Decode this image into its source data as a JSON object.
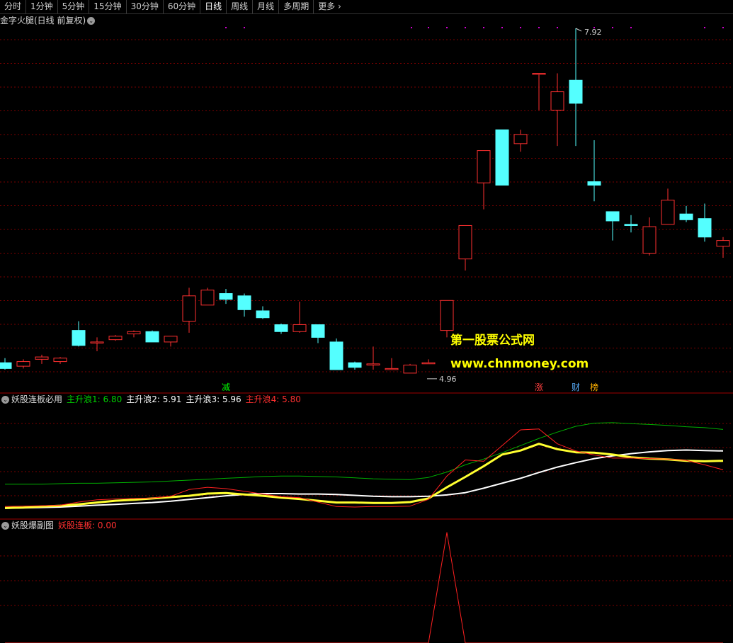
{
  "toolbar": {
    "tabs": [
      {
        "label": "分时"
      },
      {
        "label": "1分钟"
      },
      {
        "label": "5分钟"
      },
      {
        "label": "15分钟"
      },
      {
        "label": "30分钟"
      },
      {
        "label": "60分钟"
      },
      {
        "label": "日线",
        "active": true
      },
      {
        "label": "周线"
      },
      {
        "label": "月线"
      },
      {
        "label": "多周期"
      }
    ],
    "more_label": "更多",
    "more_icon": "chevron-right-icon"
  },
  "main_panel": {
    "title": "金字火腿(日线 前复权)",
    "high_label": "7.92",
    "low_label": "4.96",
    "markers": [
      {
        "text": "减",
        "color": "#00ff00"
      },
      {
        "text": "涨",
        "color": "#ff4040"
      },
      {
        "text": "财",
        "color": "#5ab0ff"
      },
      {
        "text": "榜",
        "color": "#ffb000"
      }
    ],
    "watermark_line1": "第一股票公式网",
    "watermark_line2": "www.chnmoney.com"
  },
  "indicator_panel": {
    "name": "妖股连板必用",
    "legend": [
      {
        "label": "主升浪1: 6.80",
        "color": "#00d000"
      },
      {
        "label": "主升浪2: 5.91",
        "color": "#ffffff"
      },
      {
        "label": "主升浪3: 5.96",
        "color": "#ffffff"
      },
      {
        "label": "主升浪4: 5.80",
        "color": "#ff3030"
      }
    ]
  },
  "sub_panel": {
    "name": "妖股爆副图",
    "legend": [
      {
        "label": "妖股连板: 0.00",
        "color": "#ff3030"
      }
    ]
  },
  "colors": {
    "up": "#ff3030",
    "down": "#54ffff",
    "grid": "#7a0000",
    "separator": "#a00000",
    "ma_green": "#00b000",
    "ma_white": "#ffffff",
    "ma_yellow": "#ffff30",
    "ma_red": "#ff2020"
  },
  "chart_data": [
    {
      "type": "candlestick",
      "title": "金字火腿(日线 前复权)",
      "candles": [
        {
          "o": 5.02,
          "h": 5.06,
          "l": 4.96,
          "c": 4.97
        },
        {
          "o": 4.99,
          "h": 5.05,
          "l": 4.97,
          "c": 5.03
        },
        {
          "o": 5.05,
          "h": 5.09,
          "l": 5.01,
          "c": 5.07
        },
        {
          "o": 5.03,
          "h": 5.07,
          "l": 5.01,
          "c": 5.06
        },
        {
          "o": 5.3,
          "h": 5.38,
          "l": 5.16,
          "c": 5.17
        },
        {
          "o": 5.2,
          "h": 5.24,
          "l": 5.12,
          "c": 5.2
        },
        {
          "o": 5.22,
          "h": 5.26,
          "l": 5.21,
          "c": 5.25
        },
        {
          "o": 5.27,
          "h": 5.3,
          "l": 5.24,
          "c": 5.29
        },
        {
          "o": 5.29,
          "h": 5.3,
          "l": 5.2,
          "c": 5.2
        },
        {
          "o": 5.2,
          "h": 5.24,
          "l": 5.16,
          "c": 5.25
        },
        {
          "o": 5.38,
          "h": 5.67,
          "l": 5.28,
          "c": 5.6
        },
        {
          "o": 5.52,
          "h": 5.67,
          "l": 5.52,
          "c": 5.65
        },
        {
          "o": 5.62,
          "h": 5.66,
          "l": 5.53,
          "c": 5.57
        },
        {
          "o": 5.6,
          "h": 5.62,
          "l": 5.42,
          "c": 5.48
        },
        {
          "o": 5.47,
          "h": 5.51,
          "l": 5.4,
          "c": 5.41
        },
        {
          "o": 5.35,
          "h": 5.36,
          "l": 5.27,
          "c": 5.29
        },
        {
          "o": 5.29,
          "h": 5.55,
          "l": 5.28,
          "c": 5.35
        },
        {
          "o": 5.35,
          "h": 5.35,
          "l": 5.19,
          "c": 5.24
        },
        {
          "o": 5.2,
          "h": 5.23,
          "l": 4.96,
          "c": 4.96
        },
        {
          "o": 5.02,
          "h": 5.03,
          "l": 4.96,
          "c": 4.98
        },
        {
          "o": 5.0,
          "h": 5.16,
          "l": 4.96,
          "c": 5.01
        },
        {
          "o": 4.97,
          "h": 5.06,
          "l": 4.96,
          "c": 4.97
        },
        {
          "o": 4.93,
          "h": 5.01,
          "l": 4.93,
          "c": 5.0
        },
        {
          "o": 5.02,
          "h": 5.05,
          "l": 5.01,
          "c": 5.02
        },
        {
          "o": 5.3,
          "h": 5.55,
          "l": 5.24,
          "c": 5.56
        },
        {
          "o": 5.92,
          "h": 5.92,
          "l": 5.82,
          "c": 6.21
        },
        {
          "o": 6.58,
          "h": 6.61,
          "l": 6.35,
          "c": 6.86
        },
        {
          "o": 7.04,
          "h": 7.04,
          "l": 6.56,
          "c": 6.56
        },
        {
          "o": 6.92,
          "h": 7.04,
          "l": 6.85,
          "c": 7.0
        },
        {
          "o": 7.53,
          "h": 7.53,
          "l": 7.21,
          "c": 7.53
        },
        {
          "o": 7.21,
          "h": 7.53,
          "l": 6.9,
          "c": 7.37
        },
        {
          "o": 7.47,
          "h": 7.92,
          "l": 6.9,
          "c": 7.27
        },
        {
          "o": 6.59,
          "h": 6.95,
          "l": 6.42,
          "c": 6.56
        },
        {
          "o": 6.33,
          "h": 6.33,
          "l": 6.08,
          "c": 6.25
        },
        {
          "o": 6.22,
          "h": 6.3,
          "l": 6.15,
          "c": 6.21
        },
        {
          "o": 5.97,
          "h": 6.28,
          "l": 5.95,
          "c": 6.2
        },
        {
          "o": 6.22,
          "h": 6.53,
          "l": 6.23,
          "c": 6.43
        },
        {
          "o": 6.31,
          "h": 6.38,
          "l": 6.24,
          "c": 6.26
        },
        {
          "o": 6.27,
          "h": 6.4,
          "l": 6.07,
          "c": 6.11
        },
        {
          "o": 6.03,
          "h": 6.11,
          "l": 5.93,
          "c": 6.08
        }
      ]
    },
    {
      "type": "line",
      "title": "妖股连板必用",
      "ylim": [
        4.8,
        7.2
      ],
      "series": [
        {
          "name": "主升浪1",
          "color": "#00b000",
          "width": 1,
          "values": [
            5.5,
            5.5,
            5.5,
            5.51,
            5.52,
            5.52,
            5.53,
            5.54,
            5.55,
            5.57,
            5.59,
            5.61,
            5.63,
            5.65,
            5.67,
            5.68,
            5.68,
            5.67,
            5.66,
            5.64,
            5.62,
            5.61,
            5.6,
            5.65,
            5.77,
            5.93,
            6.06,
            6.2,
            6.36,
            6.52,
            6.66,
            6.79,
            6.86,
            6.87,
            6.85,
            6.83,
            6.81,
            6.78,
            6.76,
            6.72
          ]
        },
        {
          "name": "主升浪2",
          "color": "#ffffff",
          "width": 2,
          "values": [
            4.96,
            4.97,
            4.98,
            4.99,
            5.01,
            5.03,
            5.05,
            5.07,
            5.09,
            5.12,
            5.16,
            5.2,
            5.24,
            5.27,
            5.29,
            5.29,
            5.28,
            5.28,
            5.27,
            5.25,
            5.23,
            5.22,
            5.22,
            5.23,
            5.26,
            5.31,
            5.41,
            5.52,
            5.63,
            5.76,
            5.88,
            5.98,
            6.07,
            6.13,
            6.18,
            6.22,
            6.25,
            6.26,
            6.25,
            6.24
          ]
        },
        {
          "name": "主升浪3",
          "color": "#ffff30",
          "width": 3,
          "values": [
            4.97,
            4.98,
            5.0,
            5.02,
            5.05,
            5.09,
            5.13,
            5.15,
            5.18,
            5.21,
            5.24,
            5.29,
            5.3,
            5.27,
            5.24,
            5.2,
            5.17,
            5.13,
            5.09,
            5.09,
            5.08,
            5.08,
            5.1,
            5.18,
            5.43,
            5.66,
            5.9,
            6.16,
            6.25,
            6.4,
            6.28,
            6.21,
            6.2,
            6.16,
            6.1,
            6.07,
            6.05,
            6.02,
            6.01,
            6.02
          ]
        },
        {
          "name": "主升浪4",
          "color": "#ff2020",
          "width": 1,
          "values": [
            5.0,
            5.01,
            5.02,
            5.03,
            5.1,
            5.15,
            5.17,
            5.18,
            5.19,
            5.23,
            5.38,
            5.43,
            5.4,
            5.34,
            5.28,
            5.22,
            5.2,
            5.1,
            5.0,
            4.99,
            5.0,
            5.0,
            5.01,
            5.16,
            5.68,
            6.04,
            6.01,
            6.36,
            6.71,
            6.73,
            6.4,
            6.24,
            6.15,
            6.08,
            6.08,
            6.07,
            6.06,
            6.03,
            5.93,
            5.82
          ]
        }
      ]
    },
    {
      "type": "line",
      "title": "妖股爆副图",
      "ylim": [
        0,
        1
      ],
      "series": [
        {
          "name": "妖股连板",
          "color": "#ff2020",
          "width": 1,
          "values": [
            0,
            0,
            0,
            0,
            0,
            0,
            0,
            0,
            0,
            0,
            0,
            0,
            0,
            0,
            0,
            0,
            0,
            0,
            0,
            0,
            0,
            0,
            0,
            0,
            1,
            0,
            0,
            0,
            0,
            0,
            0,
            0,
            0,
            0,
            0,
            0,
            0,
            0,
            0,
            0
          ]
        }
      ]
    }
  ]
}
